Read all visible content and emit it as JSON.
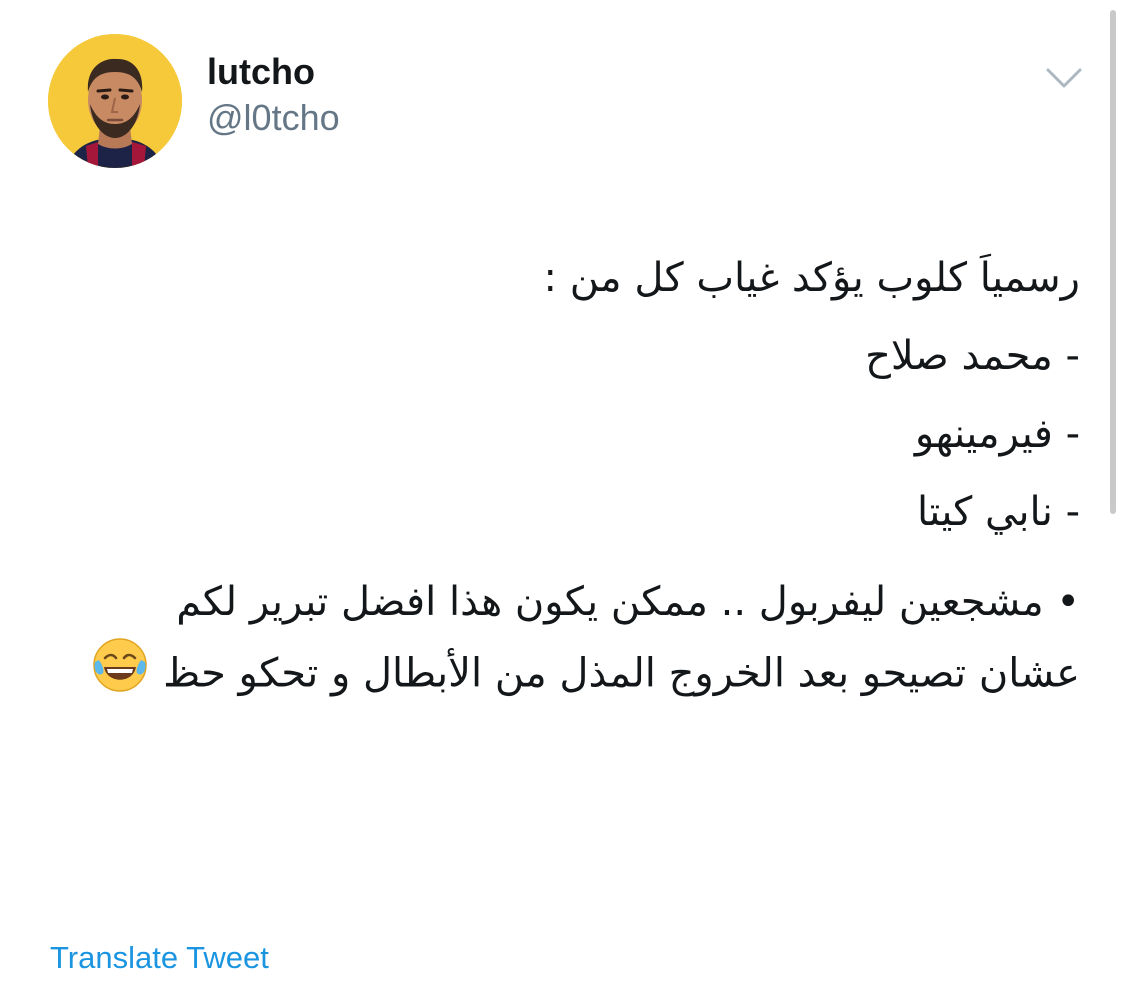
{
  "user": {
    "display_name": "lutcho",
    "handle": "@l0tcho",
    "avatar_icon": "profile-photo"
  },
  "menu": {
    "caret_icon": "chevron-down-icon"
  },
  "tweet": {
    "line1": "رسمياَ كلوب يؤكد غياب كل من :",
    "item1": "- محمد صلاح",
    "item2": "- فيرمينهو",
    "item3": "- نابي كيتا",
    "paragraph": "• مشجعين ليفربول .. ممكن يكون هذا افضل تبرير لكم عشان تصيحو بعد الخروج المذل من الأبطال و تحكو حظ",
    "emoji": "face-with-tears-of-joy"
  },
  "actions": {
    "translate_label": "Translate Tweet"
  },
  "colors": {
    "link": "#1b95e0",
    "secondary_text": "#657786",
    "avatar_bg": "#f5c93a"
  }
}
